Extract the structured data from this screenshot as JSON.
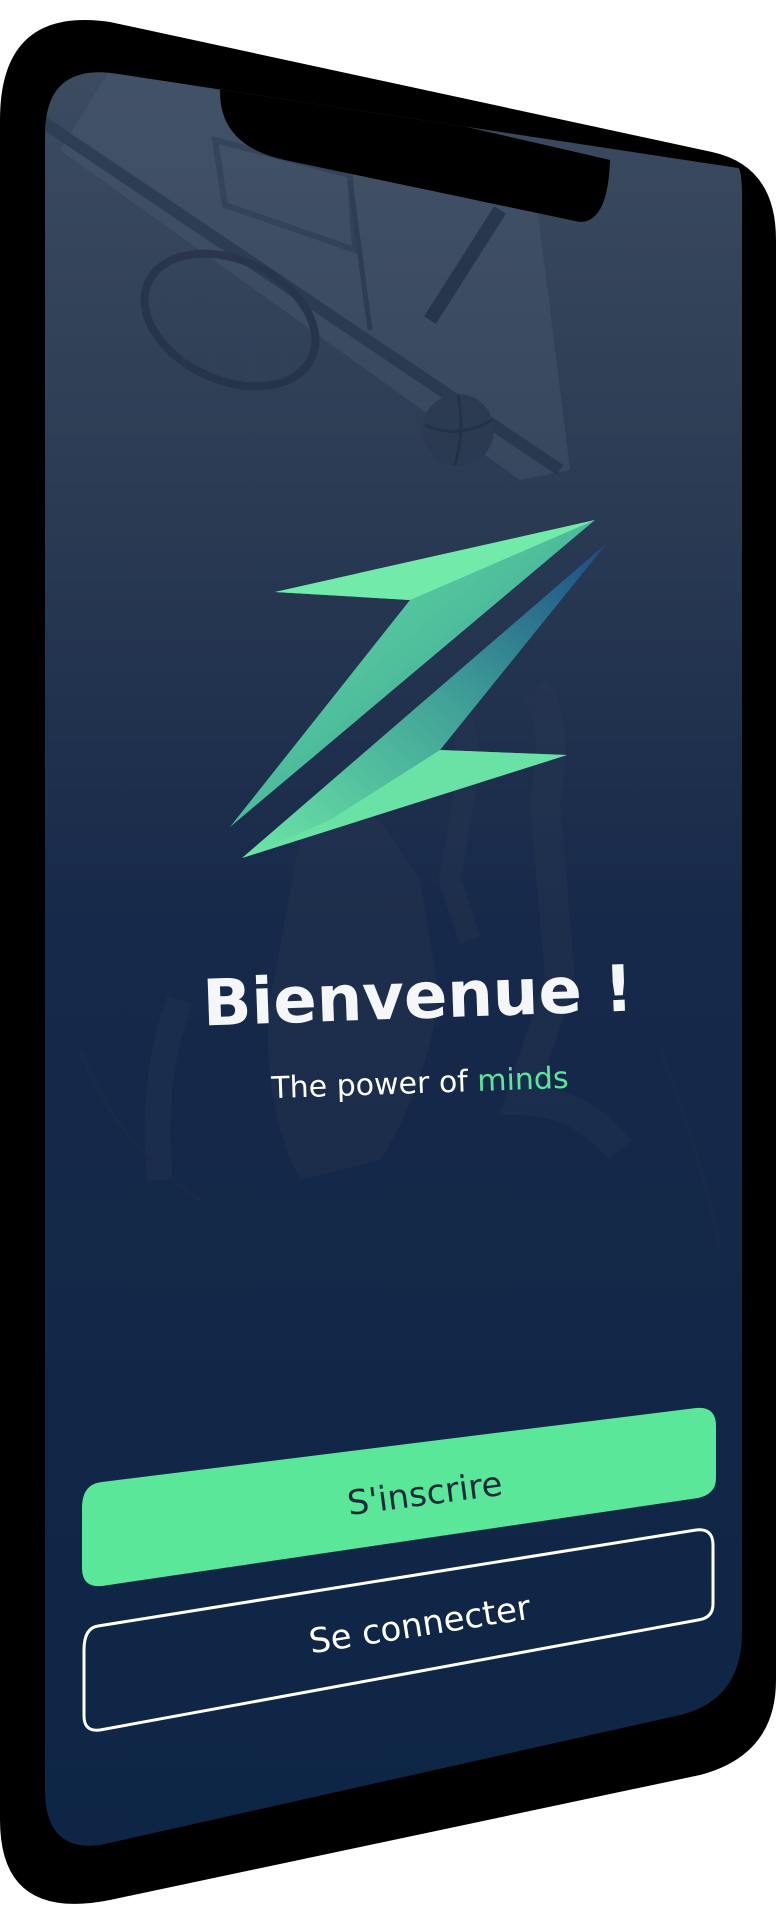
{
  "welcome": {
    "title": "Bienvenue !",
    "tagline_prefix": "The power of ",
    "tagline_highlight": "minds"
  },
  "actions": {
    "signup_label": "S'inscrire",
    "login_label": "Se connecter"
  },
  "logo": {
    "icon": "z-lightning-logo-icon"
  },
  "background": {
    "image": "basketball-hoop-players-photo"
  },
  "colors": {
    "accent": "#5BE79A",
    "screen_top": "#3B4A5E",
    "screen_bottom": "#0D2545",
    "bezel": "#000000",
    "text": "#FFFFFF"
  }
}
